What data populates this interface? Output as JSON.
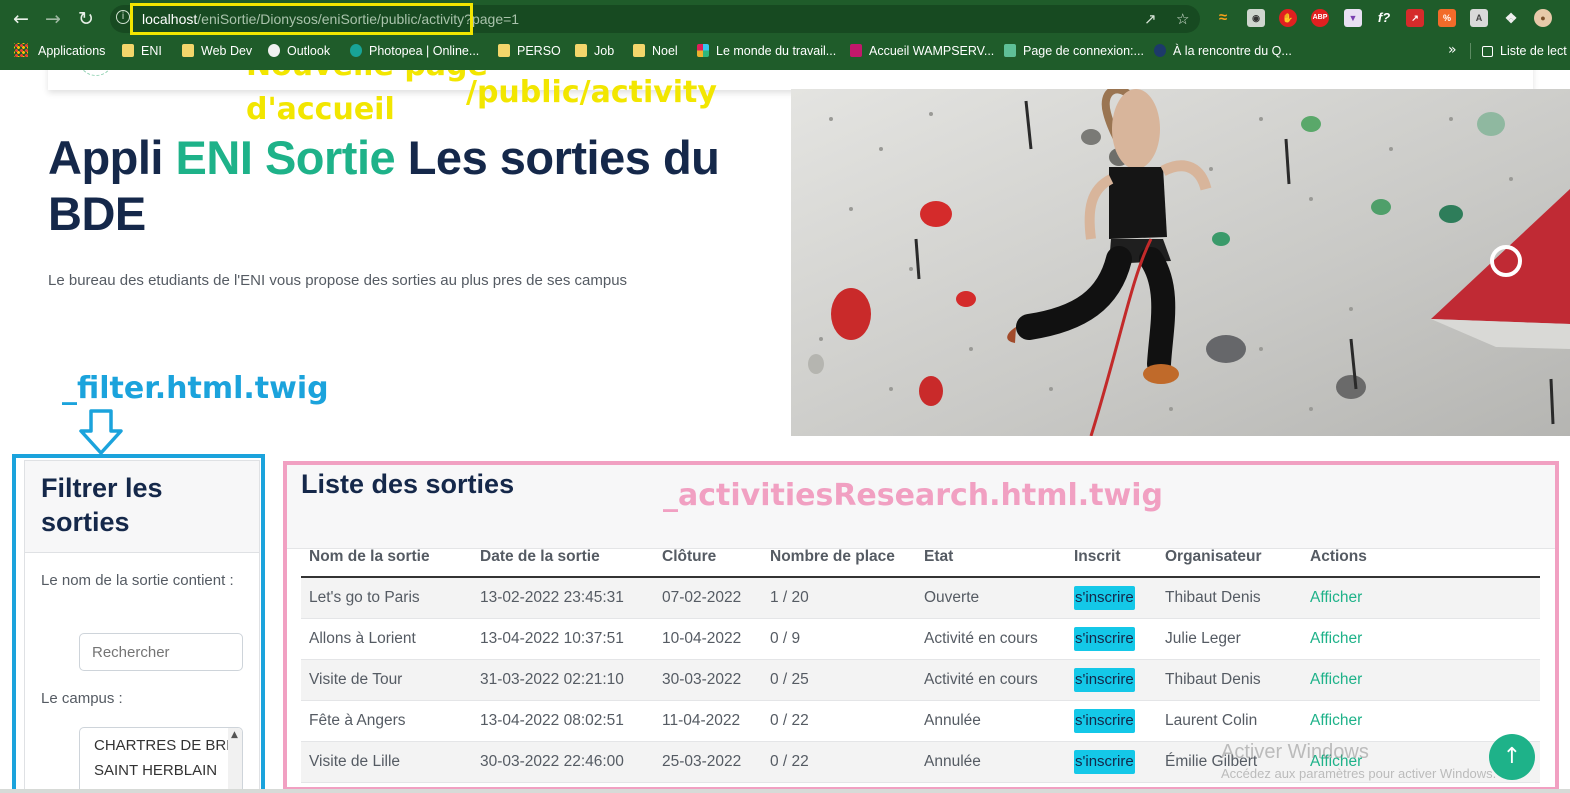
{
  "browser": {
    "url_host": "localhost",
    "url_path": "/eniSortie/Dionysos/eniSortie/public/activity",
    "url_query": "?page=1",
    "bookmarks": [
      {
        "label": "Applications"
      },
      {
        "label": "ENI"
      },
      {
        "label": "Web Dev"
      },
      {
        "label": "Outlook"
      },
      {
        "label": "Photopea | Online..."
      },
      {
        "label": "PERSO"
      },
      {
        "label": "Job"
      },
      {
        "label": "Noel"
      },
      {
        "label": "Le monde du travail..."
      },
      {
        "label": "Accueil WAMPSERV..."
      },
      {
        "label": "Page de connexion:..."
      },
      {
        "label": "À la rencontre du Q..."
      }
    ],
    "more_bookmarks": "»",
    "reading_list": "Liste de lect",
    "extensions": [
      "rss-icon",
      "camera-icon",
      "hand-icon",
      "abp-icon",
      "shield-icon",
      "fx-icon",
      "arrow-icon",
      "translate-icon",
      "a-icon",
      "puzzle-icon",
      "avatar-icon"
    ]
  },
  "hero": {
    "title_part1": "Appli ",
    "title_accent": "ENI Sortie",
    "title_part2": " Les sorties du BDE",
    "description": "Le bureau des etudiants de l'ENI vous propose des sorties au plus pres de ses campus"
  },
  "annotations": {
    "new_home_line1": "Nouvelle page",
    "new_home_line2": "d'accueil",
    "public_activity": "/public/activity",
    "filter_template": "_filter.html.twig",
    "activities_template": "_activitiesResearch.html.twig"
  },
  "filter": {
    "title": "Filtrer les sorties",
    "name_label": "Le nom de la sortie contient :",
    "search_placeholder": "Rechercher",
    "campus_label": "Le campus :",
    "campus_options": [
      "CHARTRES DE BRE",
      "SAINT HERBLAIN"
    ]
  },
  "activities": {
    "title": "Liste des sorties",
    "columns": [
      "Nom de la sortie",
      "Date de la sortie",
      "Clôture",
      "Nombre de place",
      "Etat",
      "Inscrit",
      "Organisateur",
      "Actions"
    ],
    "register_label": "s'inscrire",
    "action_label": "Afficher",
    "rows": [
      {
        "name": "Let's go to Paris",
        "date": "13-02-2022 23:45:31",
        "closing": "07-02-2022",
        "places": "1 / 20",
        "state": "Ouverte",
        "organizer": "Thibaut Denis"
      },
      {
        "name": "Allons à Lorient",
        "date": "13-04-2022 10:37:51",
        "closing": "10-04-2022",
        "places": "0 / 9",
        "state": "Activité en cours",
        "organizer": "Julie Leger"
      },
      {
        "name": "Visite de Tour",
        "date": "31-03-2022 02:21:10",
        "closing": "30-03-2022",
        "places": "0 / 25",
        "state": "Activité en cours",
        "organizer": "Thibaut Denis"
      },
      {
        "name": "Fête à Angers",
        "date": "13-04-2022 08:02:51",
        "closing": "11-04-2022",
        "places": "0 / 22",
        "state": "Annulée",
        "organizer": "Laurent Colin"
      },
      {
        "name": "Visite de Lille",
        "date": "30-03-2022 22:46:00",
        "closing": "25-03-2022",
        "places": "0 / 22",
        "state": "Annulée",
        "organizer": "Émilie Gilbert"
      }
    ]
  },
  "watermark": {
    "line1": "Activer Windows",
    "line2": "Accédez aux paramètres pour activer Windows."
  },
  "colors": {
    "chrome_green": "#1f5c2a",
    "brand_navy": "#15284a",
    "accent_green": "#1eb289",
    "register_cyan": "#14c8e8",
    "annotation_yellow": "#f2e600",
    "annotation_blue": "#1ba3dc",
    "annotation_pink": "#f1a0c2"
  }
}
